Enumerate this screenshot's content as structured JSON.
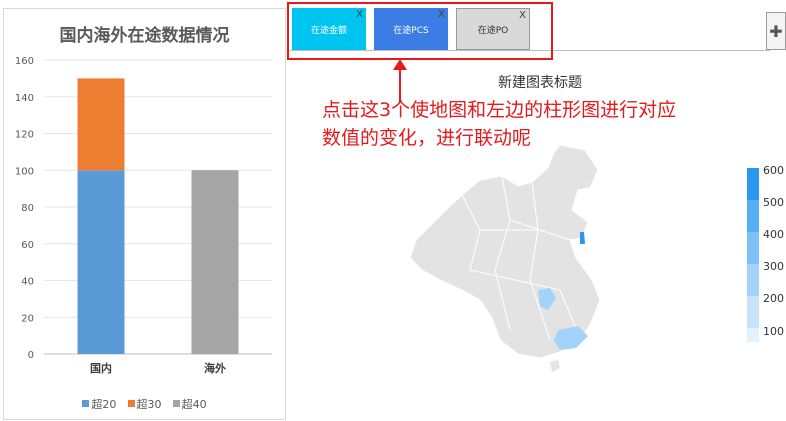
{
  "left_chart": {
    "title": "国内海外在途数据情况",
    "legend": [
      {
        "label": "超20",
        "color": "#5b9bd5"
      },
      {
        "label": "超30",
        "color": "#ed7d31"
      },
      {
        "label": "超40",
        "color": "#a5a5a5"
      }
    ]
  },
  "chart_data": {
    "type": "bar",
    "stacked": true,
    "title": "国内海外在途数据情况",
    "categories": [
      "国内",
      "海外"
    ],
    "series": [
      {
        "name": "超20",
        "values": [
          100,
          0
        ],
        "color": "#5b9bd5"
      },
      {
        "name": "超30",
        "values": [
          50,
          0
        ],
        "color": "#ed7d31"
      },
      {
        "name": "超40",
        "values": [
          0,
          100
        ],
        "color": "#a5a5a5"
      }
    ],
    "ylim": [
      0,
      160
    ],
    "yticks": [
      0,
      20,
      40,
      60,
      80,
      100,
      120,
      140,
      160
    ],
    "grid": true,
    "legend_position": "bottom"
  },
  "tabs": [
    {
      "label": "在途金额",
      "close": "X",
      "color": "#00c4f0"
    },
    {
      "label": "在途PCS",
      "close": "X",
      "color": "#3b7de4"
    },
    {
      "label": "在途PO",
      "close": "X",
      "color": "#d9d9d9"
    }
  ],
  "add_button": {
    "icon": "plus-icon"
  },
  "map": {
    "title": "新建图表标题",
    "visual_map": [
      "600",
      "500",
      "400",
      "300",
      "200",
      "100"
    ],
    "visual_map_colors": [
      "#2a98f0",
      "#56aef3",
      "#7cc0f6",
      "#a3d3f8",
      "#c8e4fb",
      "#e3f1fd"
    ]
  },
  "annotation": {
    "line1": "点击这3个使地图和左边的柱形图进行对应",
    "line2": "数值的变化，进行联动呢"
  }
}
